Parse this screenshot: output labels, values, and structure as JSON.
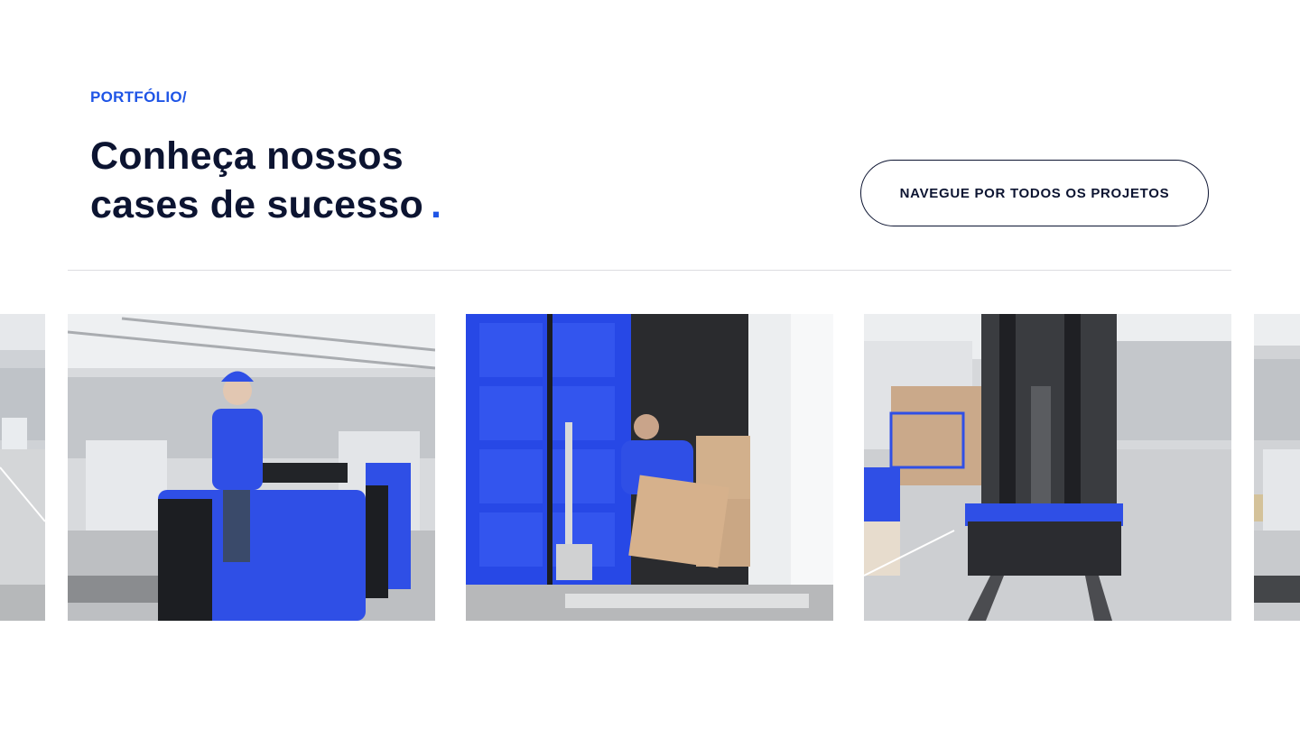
{
  "portfolio": {
    "eyebrow": "PORTFÓLIO/",
    "title_line1": "Conheça nossos",
    "title_line2": "cases de sucesso",
    "title_dot": ".",
    "cta_label": "NAVEGUE POR TODOS OS PROJETOS"
  },
  "carousel": {
    "items": [
      {
        "image": "warehouse-photo"
      },
      {
        "image": "worker-on-pallet-truck-photo"
      },
      {
        "image": "worker-unloading-container-photo"
      },
      {
        "image": "forklift-in-warehouse-photo"
      },
      {
        "image": "warehouse-photo"
      }
    ]
  },
  "colors": {
    "accent": "#1f55e6",
    "heading": "#0c1431",
    "divider": "#dcdde1"
  }
}
